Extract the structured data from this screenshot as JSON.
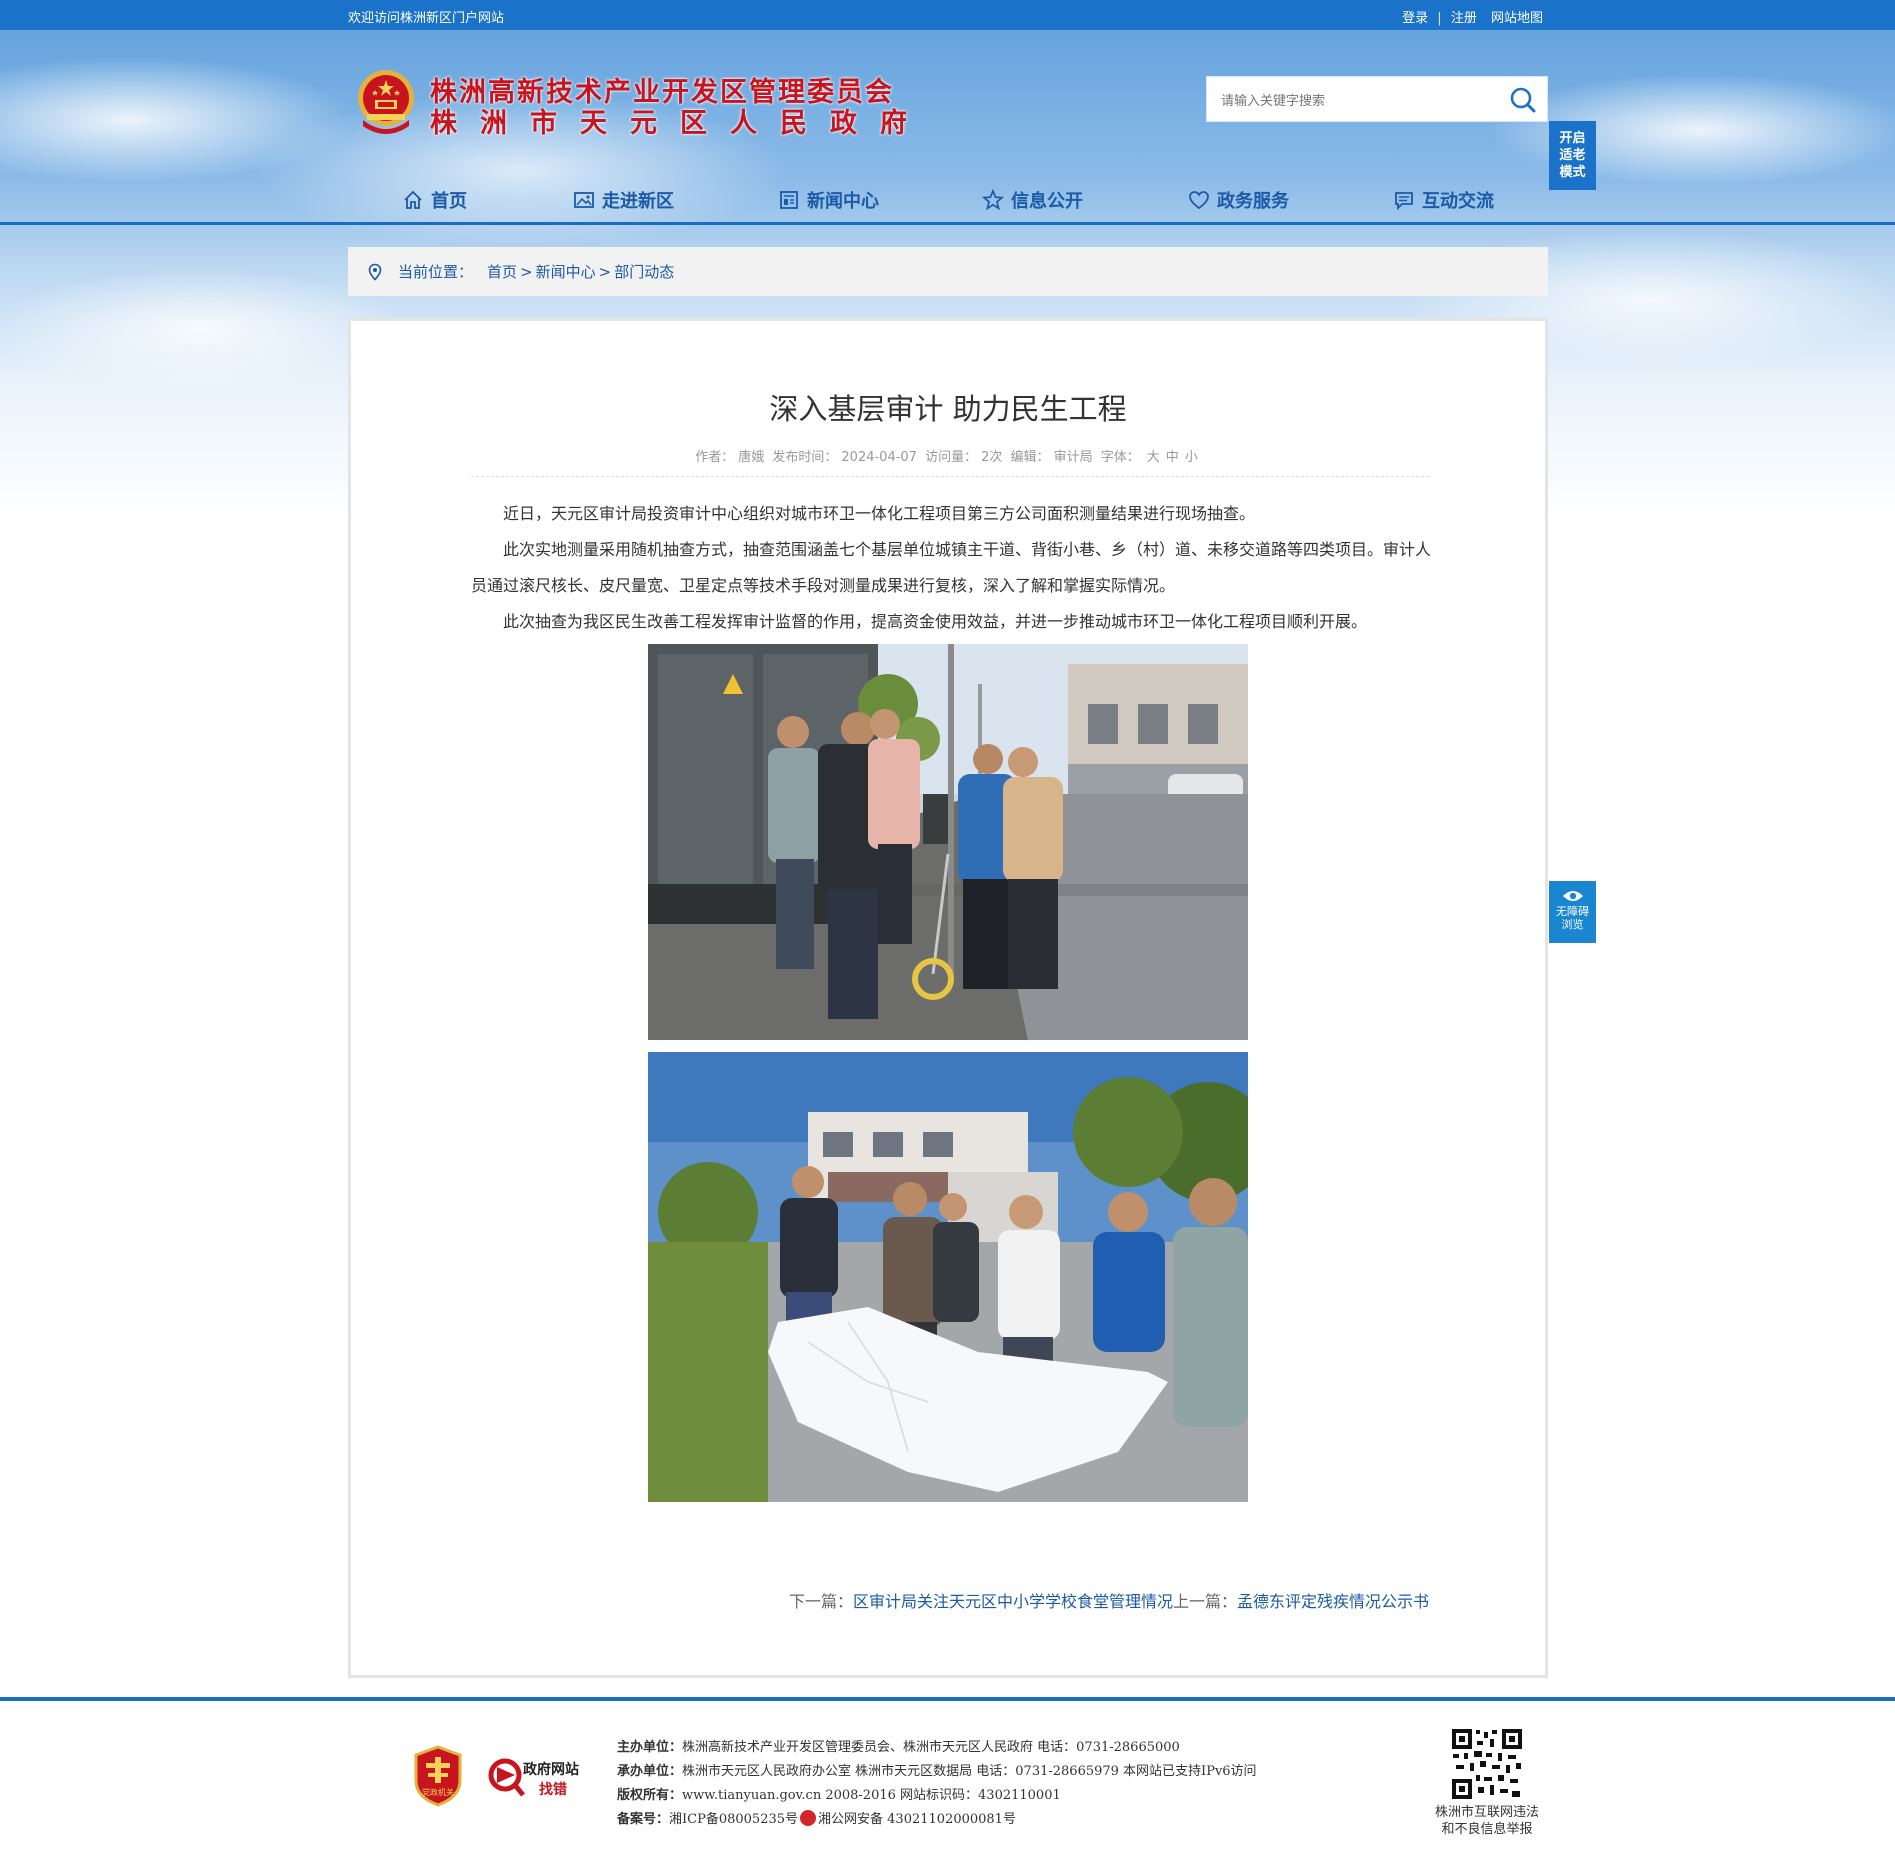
{
  "topbar": {
    "welcome": "欢迎访问株洲新区门户网站",
    "login": "登录",
    "separator": "|",
    "register": "注册",
    "sitemap": "网站地图"
  },
  "header": {
    "org_line1": "株洲高新技术产业开发区管理委员会",
    "org_line2": "株洲市天元区人民政府",
    "search_placeholder": "请输入关键字搜索",
    "elder_mode": [
      "开启",
      "适老",
      "模式"
    ]
  },
  "nav": {
    "items": [
      {
        "label": "首页",
        "icon": "home-icon"
      },
      {
        "label": "走进新区",
        "icon": "picture-icon"
      },
      {
        "label": "新闻中心",
        "icon": "newspaper-icon"
      },
      {
        "label": "信息公开",
        "icon": "star-icon"
      },
      {
        "label": "政务服务",
        "icon": "heart-icon"
      },
      {
        "label": "互动交流",
        "icon": "chat-icon"
      }
    ]
  },
  "breadcrumb": {
    "label": "当前位置：",
    "home": "首页",
    "section": "新闻中心",
    "current": "部门动态",
    "sep": ">"
  },
  "article": {
    "title": "深入基层审计 助力民生工程",
    "meta": {
      "author_label": "作者：",
      "author": "唐娥",
      "date_label": "发布时间：",
      "date": "2024-04-07",
      "views_label": "访问量：",
      "views": "2次",
      "editor_label": "编辑：",
      "editor": "审计局",
      "font_label": "字体：",
      "font_large": "大",
      "font_medium": "中",
      "font_small": "小"
    },
    "paragraphs": [
      "近日，天元区审计局投资审计中心组织对城市环卫一体化工程项目第三方公司面积测量结果进行现场抽查。",
      "此次实地测量采用随机抽查方式，抽查范围涵盖七个基层单位城镇主干道、背街小巷、乡（村）道、未移交道路等四类项目。审计人员通过滚尺核长、皮尺量宽、卫星定点等技术手段对测量成果进行复核，深入了解和掌握实际情况。",
      "此次抽查为我区民生改善工程发挥审计监督的作用，提高资金使用效益，并进一步推动城市环卫一体化工程项目顺利开展。"
    ],
    "next_label": "下一篇：",
    "next_title": "区审计局关注天元区中小学学校食堂管理情况",
    "prev_label": "上一篇：",
    "prev_title": "孟德东评定残疾情况公示书"
  },
  "a11y": {
    "line1": "无障碍",
    "line2": "浏览"
  },
  "footer": {
    "host_label": "主办单位：",
    "host": "株洲高新技术产业开发区管理委员会、株洲市天元区人民政府 电话：0731-28665000",
    "org_label": "承办单位：",
    "org": "株洲市天元区人民政府办公室 株洲市天元区数据局 电话：0731-28665979 本网站已支持IPv6访问",
    "copyright_label": "版权所有：",
    "copyright": "www.tianyuan.gov.cn 2008-2016 网站标识码：4302110001",
    "icp_label": "备案号：",
    "icp": "湘ICP备08005235号",
    "police": "湘公网安备 43021102000081号",
    "badge_text": "党政机关",
    "find_error_line1": "政府网站",
    "find_error_line2": "找错",
    "report_line1": "株洲市互联网违法",
    "report_line2": "和不良信息举报"
  },
  "colors": {
    "primary_blue": "#1a73c8",
    "logo_red": "#c8141e",
    "nav_text": "#1c5aa6"
  }
}
